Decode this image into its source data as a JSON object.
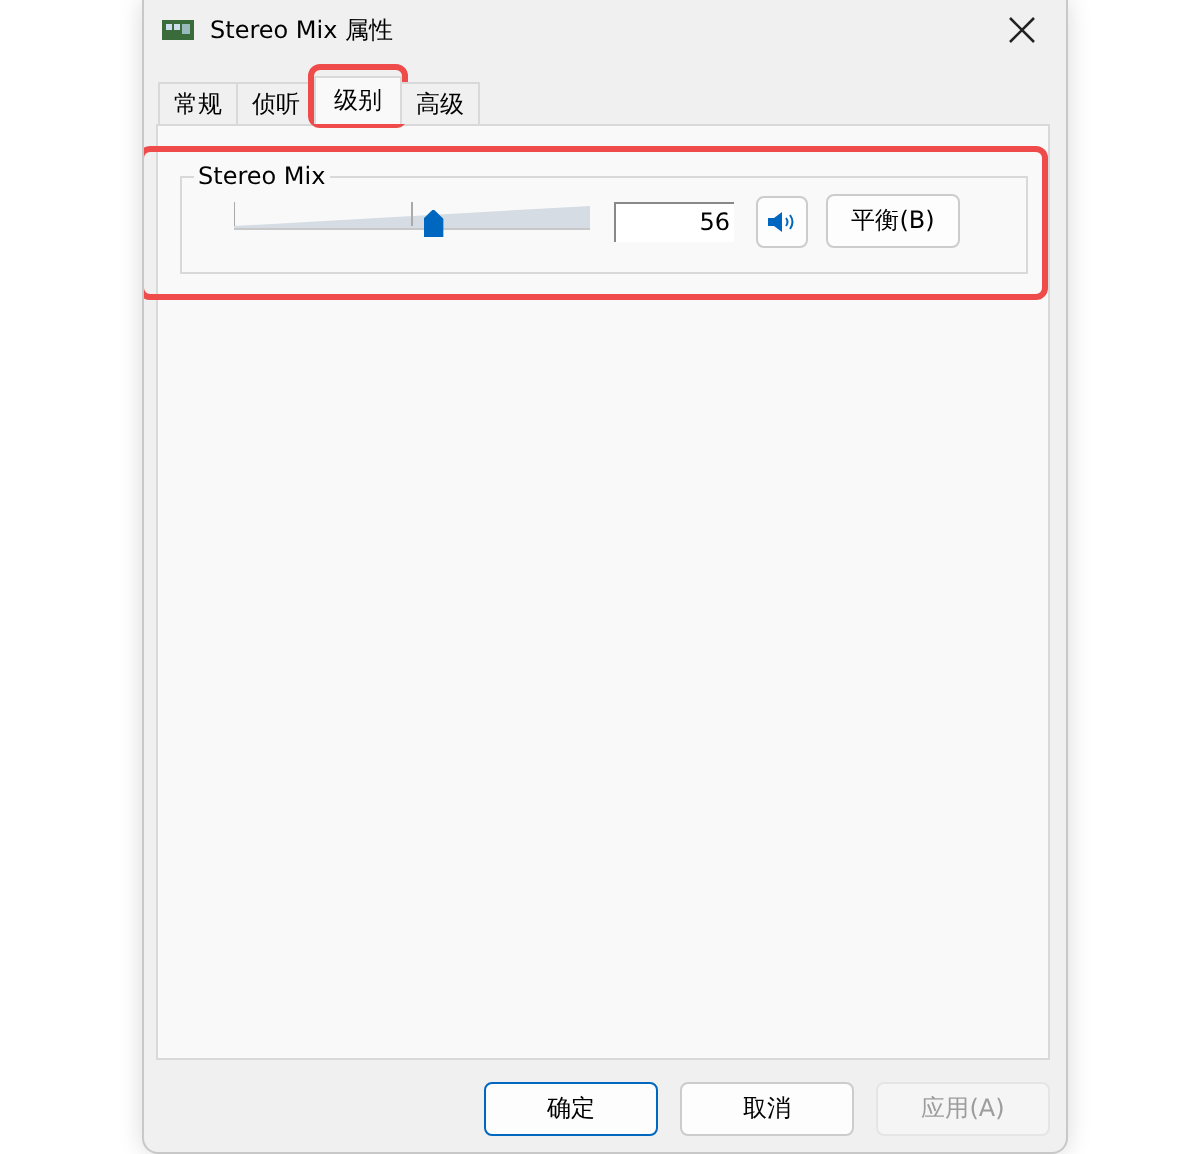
{
  "window": {
    "title": "Stereo Mix 属性"
  },
  "tabs": [
    {
      "label": "常规",
      "selected": false,
      "highlighted": false
    },
    {
      "label": "侦听",
      "selected": false,
      "highlighted": false
    },
    {
      "label": "级别",
      "selected": true,
      "highlighted": true
    },
    {
      "label": "高级",
      "selected": false,
      "highlighted": false
    }
  ],
  "level_group": {
    "title": "Stereo Mix",
    "highlighted": true,
    "level": 0.56,
    "value": "56",
    "muted": false,
    "balance_button": "平衡(B)"
  },
  "buttons": [
    {
      "label": "确定",
      "default": true,
      "disabled": false
    },
    {
      "label": "取消",
      "default": false,
      "disabled": false
    },
    {
      "label": "应用(A)",
      "default": false,
      "disabled": true
    }
  ]
}
